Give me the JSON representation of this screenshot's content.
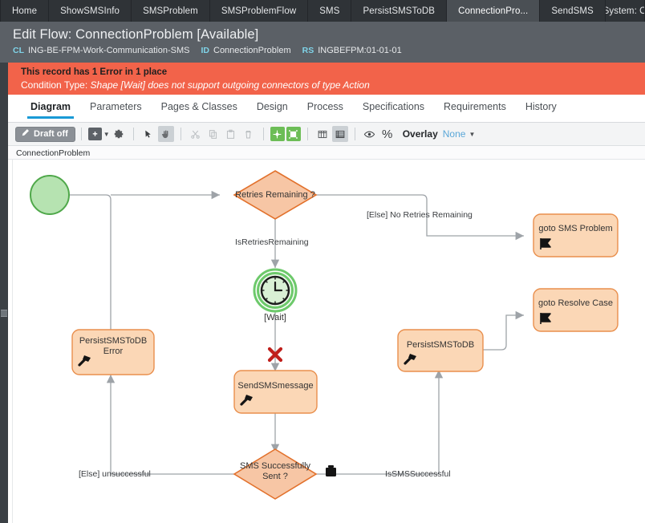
{
  "window_tabs": [
    {
      "label": "Home",
      "active": false
    },
    {
      "label": "ShowSMSInfo",
      "active": false
    },
    {
      "label": "SMSProblem",
      "active": false
    },
    {
      "label": "SMSProblemFlow",
      "active": false
    },
    {
      "label": "SMS",
      "active": false
    },
    {
      "label": "PersistSMSToDB",
      "active": false
    },
    {
      "label": "ConnectionPro...",
      "active": true
    },
    {
      "label": "SendSMS",
      "active": false
    },
    {
      "label": "System: O",
      "active": false
    }
  ],
  "header": {
    "title": "Edit Flow: ConnectionProblem [Available]",
    "class_key": "CL",
    "class_value": "ING-BE-FPM-Work-Communication-SMS",
    "id_key": "ID",
    "id_value": "ConnectionProblem",
    "ruleset_key": "RS",
    "ruleset_value": "INGBEFPM:01-01-01"
  },
  "error_banner": {
    "headline": "This record has 1 Error in 1 place",
    "detail_prefix": "Condition Type:",
    "detail_message": "Shape [Wait] does not support outgoing connectors of type Action",
    "color": "#f2634a"
  },
  "nav_tabs": [
    {
      "label": "Diagram",
      "active": true
    },
    {
      "label": "Parameters",
      "active": false
    },
    {
      "label": "Pages & Classes",
      "active": false
    },
    {
      "label": "Design",
      "active": false
    },
    {
      "label": "Process",
      "active": false
    },
    {
      "label": "Specifications",
      "active": false
    },
    {
      "label": "Requirements",
      "active": false
    },
    {
      "label": "History",
      "active": false
    }
  ],
  "toolbar": {
    "draft_label": "Draft off",
    "draft_icon": "pencil-icon",
    "add_icon": "add-shape-icon",
    "settings_icon": "gear-icon",
    "pointer_icon": "pointer-icon",
    "pan_icon": "hand-pan-icon",
    "cut_icon": "scissors-icon",
    "copy_icon": "copy-icon",
    "paste_icon": "paste-icon",
    "delete_icon": "trash-icon",
    "snap_icon": "snap-to-grid-icon",
    "autoarrange_icon": "auto-arrange-icon",
    "columns_icon": "columns-layout-icon",
    "rows_icon": "rows-layout-icon",
    "visibility_icon": "eye-icon",
    "zoom_icon": "percent-zoom-icon",
    "overlay_label": "Overlay",
    "overlay_value": "None",
    "overlay_caret": "chevron-down-icon"
  },
  "breadcrumb": {
    "label": "ConnectionProblem"
  },
  "diagram": {
    "accent_shape_fill": "#fbd7b6",
    "accent_shape_stroke": "#e98f4d",
    "decision_fill": "#f7c6a5",
    "decision_stroke": "#e2712c",
    "start_fill": "#b6e3b1",
    "start_stroke": "#4fa84a",
    "nodes": [
      {
        "id": "start",
        "type": "start-event",
        "label": ""
      },
      {
        "id": "retries",
        "type": "decision",
        "label": "Retries Remaining ?"
      },
      {
        "id": "goto_sms",
        "type": "goto-shape",
        "label": "goto SMS Problem",
        "icon": "flag-goto-icon"
      },
      {
        "id": "wait",
        "type": "wait-event",
        "label": "[Wait]",
        "icon": "clock-icon"
      },
      {
        "id": "persist_err",
        "type": "utility-shape",
        "label": "PersistSMSToDB Error",
        "label_line1": "PersistSMSToDB",
        "label_line2": "Error",
        "icon": "hammer-icon"
      },
      {
        "id": "send_sms",
        "type": "utility-shape",
        "label": "SendSMSmessage",
        "icon": "hammer-icon",
        "error_marker": "red-x-error-icon"
      },
      {
        "id": "persist",
        "type": "utility-shape",
        "label": "PersistSMSToDB",
        "icon": "hammer-icon"
      },
      {
        "id": "goto_resolve",
        "type": "goto-shape",
        "label": "goto Resolve Case",
        "icon": "flag-goto-icon"
      },
      {
        "id": "sms_ok",
        "type": "decision",
        "label": "SMS Successfully Sent ?",
        "label_line1": "SMS Successfully",
        "label_line2": "Sent ?",
        "icon": "case-briefcase-icon"
      }
    ],
    "edge_labels": [
      {
        "id": "retries_yes",
        "text": "IsRetriesRemaining"
      },
      {
        "id": "retries_else",
        "text": "[Else] No Retries Remaining"
      },
      {
        "id": "sms_else",
        "text": "[Else] unsuccessful"
      },
      {
        "id": "sms_yes",
        "text": "IsSMSSuccessful"
      }
    ]
  }
}
